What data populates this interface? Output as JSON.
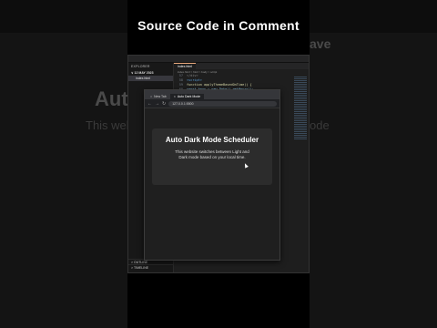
{
  "headline": "Source Code in Comment",
  "background": {
    "left_heading": "Auto",
    "left_text": "This webs",
    "right_heading": "ave",
    "right_text": "ode"
  },
  "ide": {
    "explorer_title": "EXPLORER",
    "folder": "∨ 12 MAY 2023",
    "file": "index.html",
    "outline": "> OUTLINE",
    "timeline": "> TIMELINE",
    "tab": "index.html",
    "breadcrumb": "index.html > html > body > script",
    "code": [
      {
        "n": "57",
        "t": "  </div>"
      },
      {
        "n": "58",
        "t": "  <script>"
      },
      {
        "n": "59",
        "t": "    function applyThemeBasedOnTime() {"
      },
      {
        "n": "60",
        "t": "      const hour = new Date().getHours();"
      }
    ]
  },
  "browser": {
    "tab1": "New Tab",
    "tab2": "Auto Dark Mode",
    "url": "127.0.0.1:5500",
    "card_title": "Auto Dark Mode Scheduler",
    "card_text": "This website switches between Light and Dark mode based on your local time."
  }
}
